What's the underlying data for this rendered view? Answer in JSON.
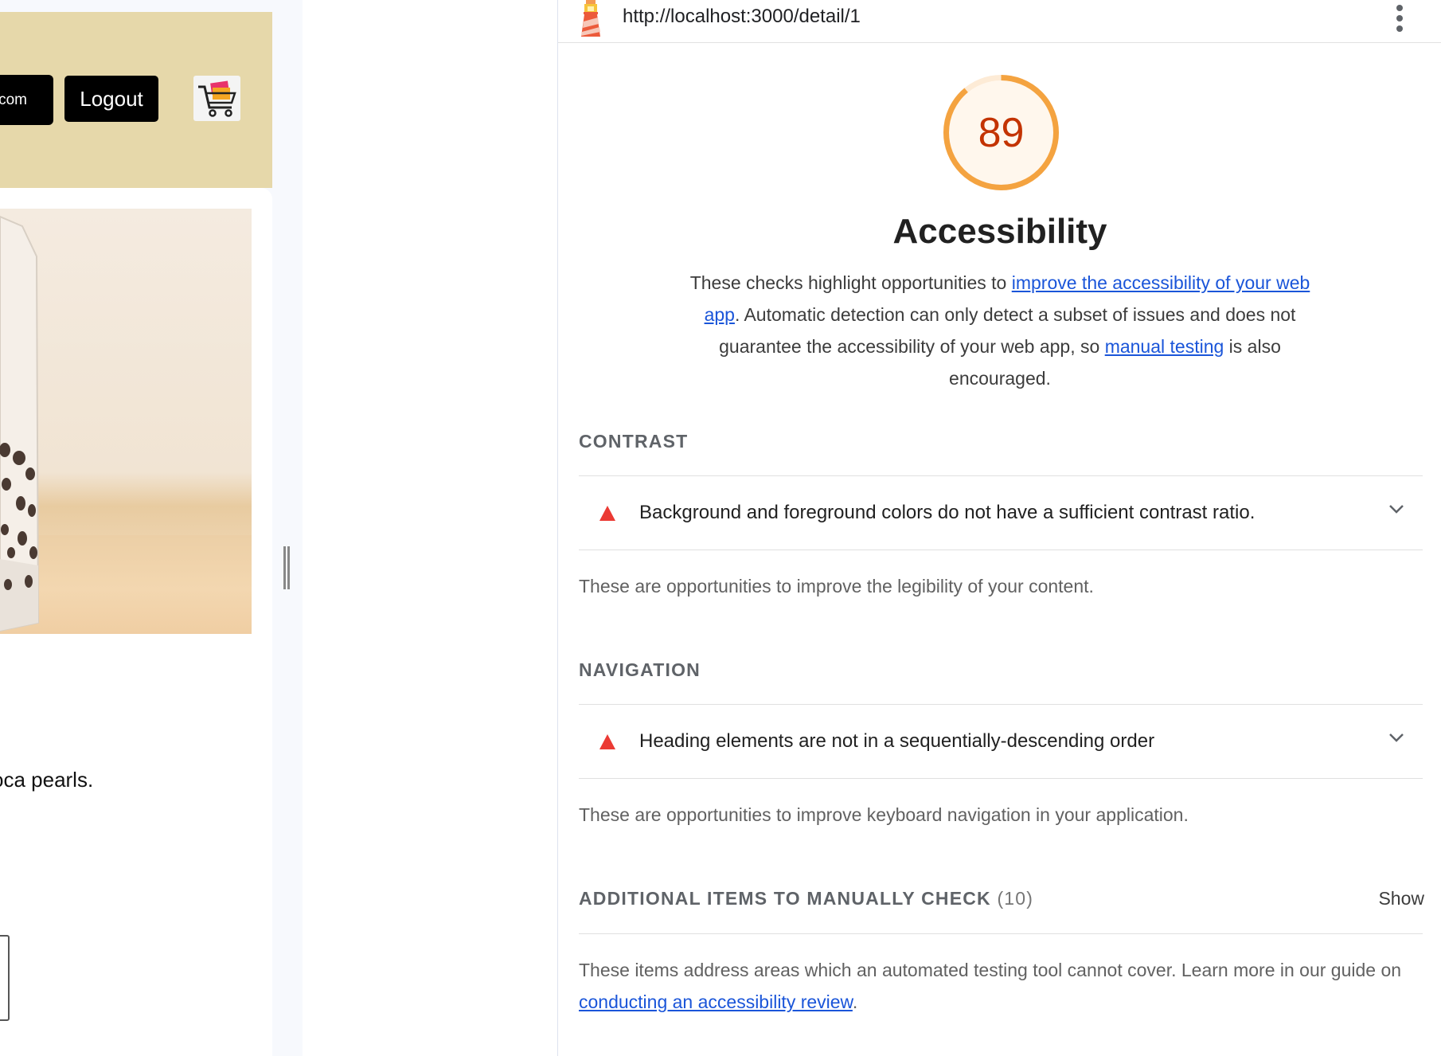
{
  "app": {
    "email_button_label": "com",
    "logout_label": "Logout",
    "product_description": "oca pearls."
  },
  "report": {
    "url": "http://localhost:3000/detail/1",
    "score": "89",
    "score_fraction": 0.89,
    "score_color": "#f4a340",
    "score_text_color": "#c33300",
    "category_title": "Accessibility",
    "description": {
      "part1": "These checks highlight opportunities to ",
      "link1": "improve the accessibility of your web app",
      "part2": ". Automatic detection can only detect a subset of issues and does not guarantee the accessibility of your web app, so ",
      "link2": "manual testing",
      "part3": " is also encouraged."
    },
    "groups": {
      "contrast": {
        "title": "CONTRAST",
        "audit": "Background and foreground colors do not have a sufficient contrast ratio.",
        "description": "These are opportunities to improve the legibility of your content."
      },
      "navigation": {
        "title": "NAVIGATION",
        "audit": "Heading elements are not in a sequentially-descending order",
        "description": "These are opportunities to improve keyboard navigation in your application."
      },
      "manual": {
        "title": "ADDITIONAL ITEMS TO MANUALLY CHECK",
        "count": "(10)",
        "toggle": "Show",
        "description_part1": "These items address areas which an automated testing tool cannot cover. Learn more in our guide on ",
        "description_link": "conducting an accessibility review",
        "description_part2": "."
      }
    },
    "fail_color": "#eb3a34",
    "link_color": "#1a55d9"
  }
}
